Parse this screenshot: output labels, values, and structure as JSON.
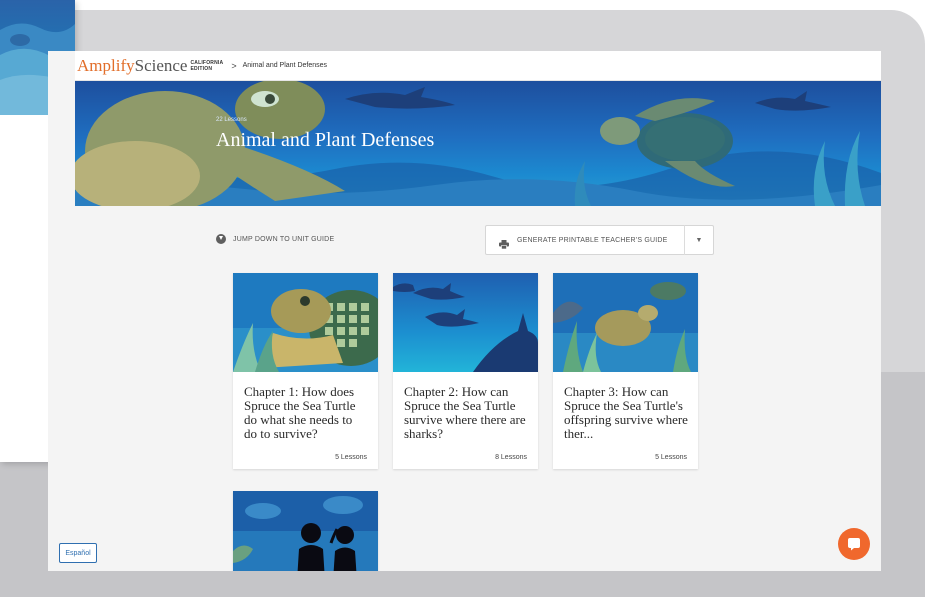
{
  "topbar": {
    "logo_primary": "Amplify",
    "logo_secondary": "Science",
    "logo_edition_line1": "CALIFORNIA",
    "logo_edition_line2": "EDITION",
    "breadcrumb_separator": ">",
    "breadcrumb_current": "Animal and Plant Defenses"
  },
  "hero": {
    "eyebrow": "22 Lessons",
    "title": "Animal and Plant Defenses"
  },
  "actions": {
    "jump_label": "JUMP DOWN TO UNIT GUIDE",
    "jump_icon": "chevron-down-circle-icon",
    "guide_label": "GENERATE PRINTABLE TEACHER'S GUIDE",
    "guide_icon": "printer-icon",
    "guide_caret_icon": "caret-down-icon",
    "guide_caret": "▼"
  },
  "chapters": [
    {
      "title": "Chapter 1: How does Spruce the Sea Turtle do what she needs to do to survive?",
      "lessons": "5 Lessons"
    },
    {
      "title": "Chapter 2: How can Spruce the Sea Turtle survive where there are sharks?",
      "lessons": "8 Lessons"
    },
    {
      "title": "Chapter 3: How can Spruce the Sea Turtle's offspring survive where ther...",
      "lessons": "5 Lessons"
    }
  ],
  "footer": {
    "language_button": "Español",
    "chat_icon": "chat-bubble-icon"
  },
  "colors": {
    "brand_orange": "#e26e2a",
    "hero_blue": "#1f6ec0",
    "link_blue": "#2f6fb0",
    "chat_orange": "#f0682d"
  }
}
